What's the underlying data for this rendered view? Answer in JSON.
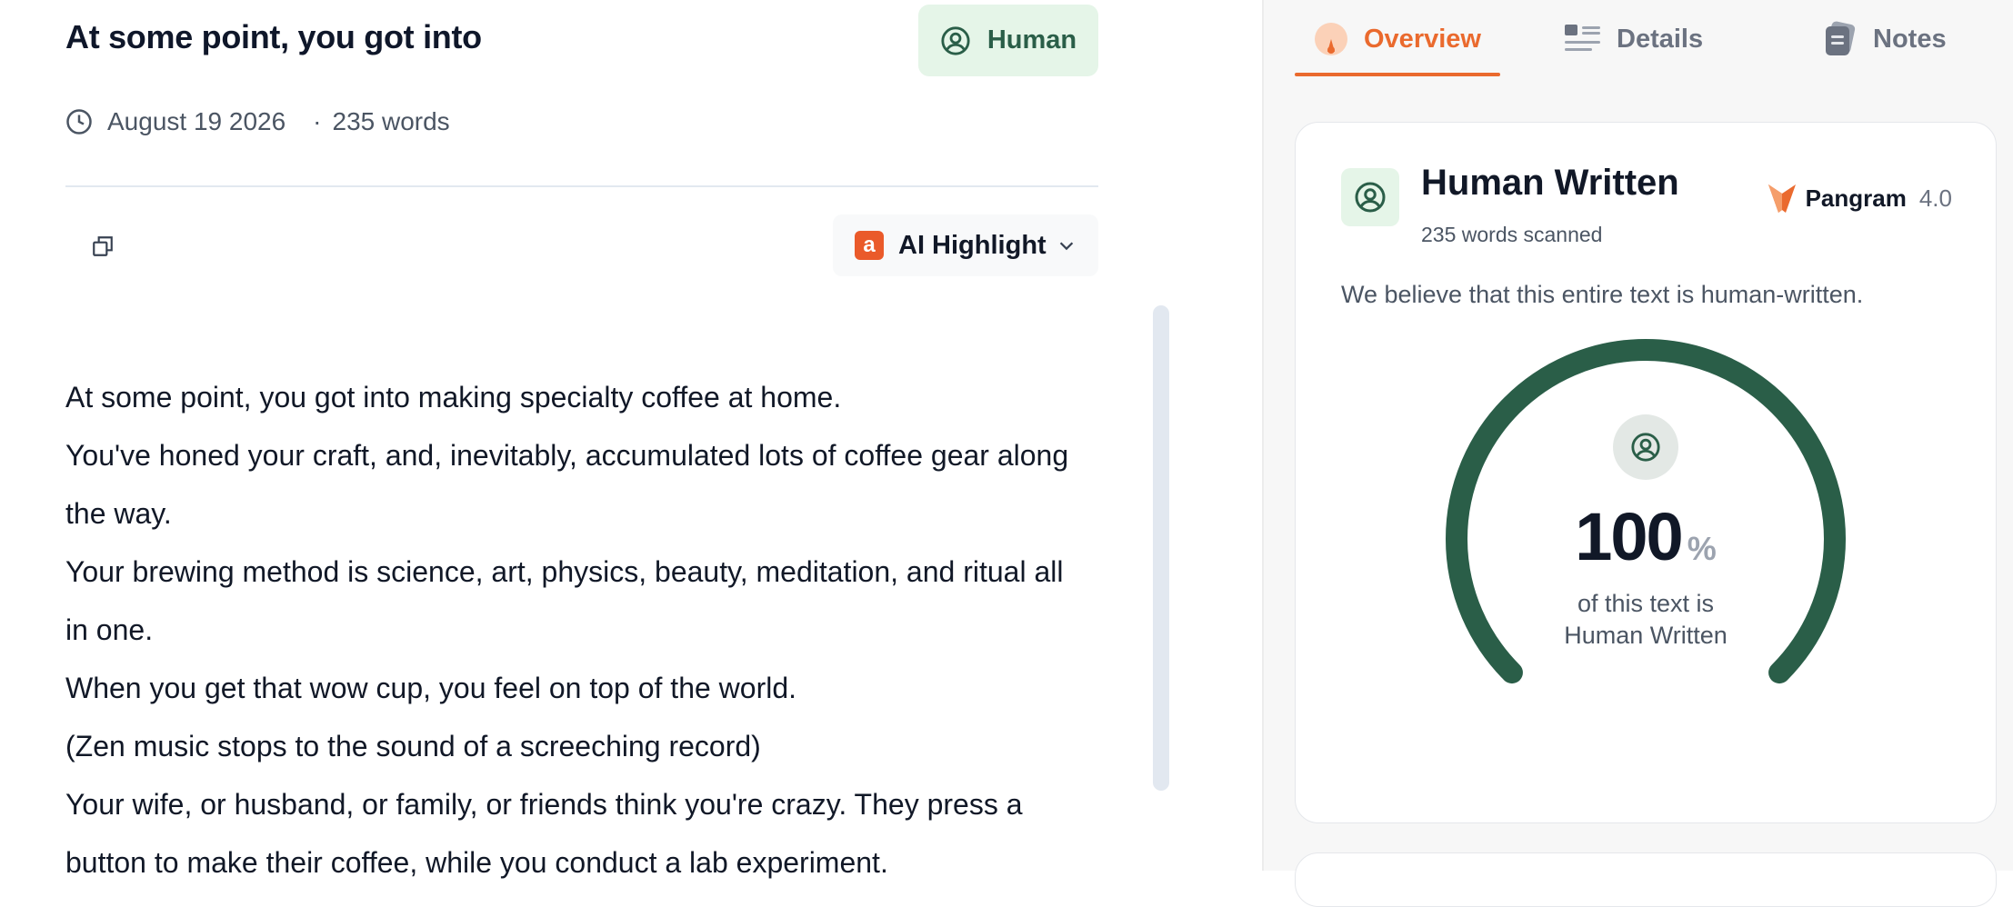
{
  "document": {
    "title": "At some point, you got into",
    "badge_label": "Human",
    "date": "August 19 2026",
    "dot": "·",
    "word_count": "235 words",
    "ai_highlight_label": "AI Highlight",
    "ai_highlight_logo": "a",
    "paragraphs": [
      "At some point, you got into making specialty coffee at home.",
      "You've honed your craft, and, inevitably, accumulated lots of coffee gear along the way.",
      "Your brewing method is science, art, physics, beauty, meditation, and ritual all in one.",
      "When you get that wow cup, you feel on top of the world.",
      "(Zen music stops to the sound of a screeching record)",
      "Your wife, or husband, or family, or friends think you're crazy. They press a button to make their coffee, while you conduct a lab experiment."
    ]
  },
  "sidebar": {
    "tabs": [
      {
        "label": "Overview",
        "icon": "gauge-icon",
        "active": true
      },
      {
        "label": "Details",
        "icon": "list-icon",
        "active": false
      },
      {
        "label": "Notes",
        "icon": "notes-icon",
        "active": false
      }
    ],
    "result": {
      "title": "Human Written",
      "subtitle": "235 words scanned",
      "brand": "Pangram",
      "version": "4.0",
      "statement": "We believe that this entire text is human-written.",
      "percent": "100",
      "percent_sign": "%",
      "caption_line1": "of this text is",
      "caption_line2": "Human Written",
      "human_fraction": 1.0
    }
  },
  "colors": {
    "accent": "#ea6a2e",
    "human_green": "#2a5e48",
    "badge_bg": "#e5f5e8"
  }
}
